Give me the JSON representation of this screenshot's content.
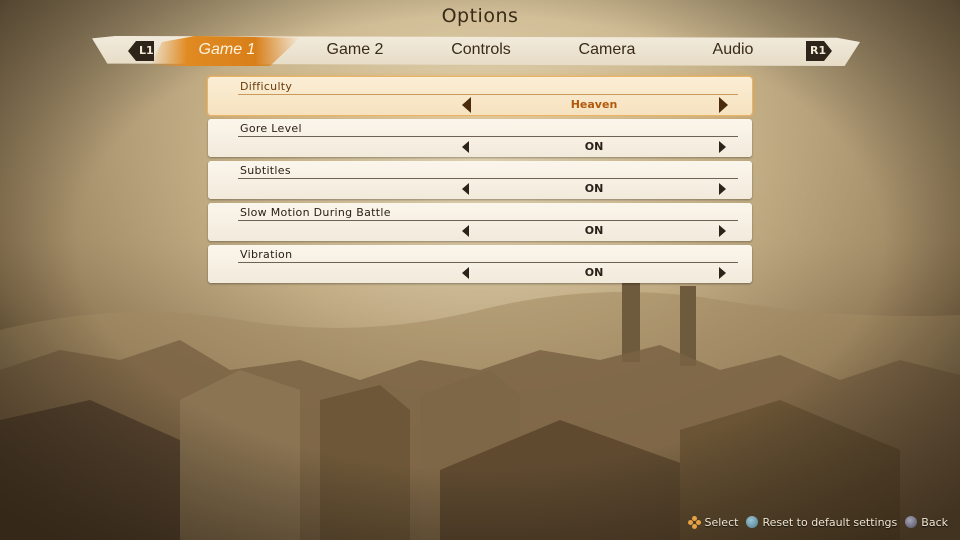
{
  "screen": {
    "title": "Options"
  },
  "tabs": {
    "left_shoulder": "L1",
    "right_shoulder": "R1",
    "active_index": 0,
    "items": [
      {
        "label": "Game 1"
      },
      {
        "label": "Game 2"
      },
      {
        "label": "Controls"
      },
      {
        "label": "Camera"
      },
      {
        "label": "Audio"
      }
    ]
  },
  "options": [
    {
      "label": "Difficulty",
      "value": "Heaven",
      "selected": true
    },
    {
      "label": "Gore Level",
      "value": "ON",
      "selected": false
    },
    {
      "label": "Subtitles",
      "value": "ON",
      "selected": false
    },
    {
      "label": "Slow Motion During Battle",
      "value": "ON",
      "selected": false
    },
    {
      "label": "Vibration",
      "value": "ON",
      "selected": false
    }
  ],
  "footer": {
    "select_label": "Select",
    "reset_label": "Reset to default settings",
    "back_label": "Back"
  },
  "colors": {
    "accent_orange": "#e08a22",
    "selected_value": "#b3590c",
    "panel_bg": "#f8f2e6"
  }
}
